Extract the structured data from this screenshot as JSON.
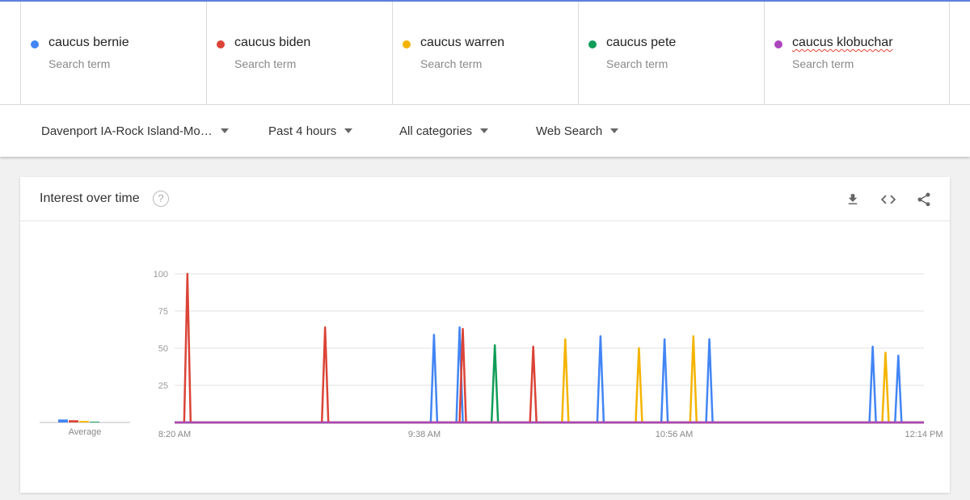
{
  "search_terms": [
    {
      "name": "caucus bernie",
      "sub": "Search term",
      "color": "#4285f4"
    },
    {
      "name": "caucus biden",
      "sub": "Search term",
      "color": "#db4437"
    },
    {
      "name": "caucus warren",
      "sub": "Search term",
      "color": "#f4b400"
    },
    {
      "name": "caucus pete",
      "sub": "Search term",
      "color": "#0f9d58"
    },
    {
      "name": "caucus klobuchar",
      "sub": "Search term",
      "color": "#ab47bc"
    }
  ],
  "filters": {
    "region": "Davenport IA-Rock Island-Mo…",
    "time": "Past 4 hours",
    "category": "All categories",
    "search_type": "Web Search"
  },
  "card": {
    "title": "Interest over time",
    "help_glyph": "?",
    "tools": [
      "download-icon",
      "embed-icon",
      "share-icon"
    ]
  },
  "chart_data": {
    "type": "line",
    "title": "Interest over time",
    "xlabel": "",
    "ylabel": "",
    "ylim": [
      0,
      100
    ],
    "yticks": [
      25,
      50,
      75,
      100
    ],
    "xlim": [
      "8:20 AM",
      "12:14 PM"
    ],
    "xtick_labels": [
      "8:20 AM",
      "9:38 AM",
      "10:56 AM",
      "12:14 PM"
    ],
    "x_domain_minutes": [
      0,
      234
    ],
    "grid": true,
    "average_label": "Average",
    "averages": [
      {
        "name": "caucus bernie",
        "value": 2
      },
      {
        "name": "caucus biden",
        "value": 1.5
      },
      {
        "name": "caucus warren",
        "value": 1
      },
      {
        "name": "caucus pete",
        "value": 0.5
      },
      {
        "name": "caucus klobuchar",
        "value": 0
      }
    ],
    "series": [
      {
        "name": "caucus bernie",
        "color": "#4285f4",
        "spikes": [
          [
            81,
            59
          ],
          [
            89,
            64
          ],
          [
            133,
            58
          ],
          [
            153,
            56
          ],
          [
            167,
            56
          ],
          [
            218,
            51
          ],
          [
            226,
            45
          ]
        ]
      },
      {
        "name": "caucus biden",
        "color": "#db4437",
        "spikes": [
          [
            4,
            100
          ],
          [
            47,
            64
          ],
          [
            90,
            63
          ],
          [
            112,
            51
          ]
        ]
      },
      {
        "name": "caucus warren",
        "color": "#f4b400",
        "spikes": [
          [
            122,
            56
          ],
          [
            145,
            50
          ],
          [
            162,
            58
          ],
          [
            222,
            47
          ]
        ]
      },
      {
        "name": "caucus pete",
        "color": "#0f9d58",
        "spikes": [
          [
            100,
            52
          ]
        ]
      },
      {
        "name": "caucus klobuchar",
        "color": "#ab47bc",
        "spikes": []
      }
    ]
  }
}
